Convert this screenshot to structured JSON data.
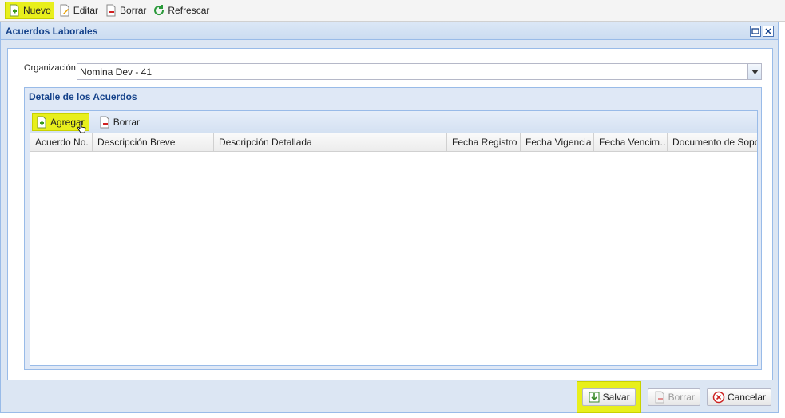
{
  "toolbar": {
    "nuevo": "Nuevo",
    "editar": "Editar",
    "borrar": "Borrar",
    "refrescar": "Refrescar"
  },
  "window": {
    "title": "Acuerdos Laborales"
  },
  "form": {
    "org_label": "Organización",
    "org_value": "Nomina Dev - 41"
  },
  "fieldset": {
    "title": "Detalle de los Acuerdos"
  },
  "grid": {
    "add_label": "Agregar",
    "delete_label": "Borrar",
    "columns": [
      "Acuerdo No.",
      "Descripción Breve",
      "Descripción Detallada",
      "Fecha Registro",
      "Fecha Vigencia",
      "Fecha Vencim…",
      "Documento de Sopo…"
    ]
  },
  "footer": {
    "save": "Salvar",
    "delete": "Borrar",
    "cancel": "Cancelar"
  },
  "icons": {
    "nuevo": "add-document-icon",
    "editar": "edit-document-icon",
    "borrar": "delete-document-icon",
    "refrescar": "refresh-icon"
  },
  "colors": {
    "highlight": "#e8ef1c",
    "title": "#15428b",
    "panel_border": "#99bbe8"
  }
}
